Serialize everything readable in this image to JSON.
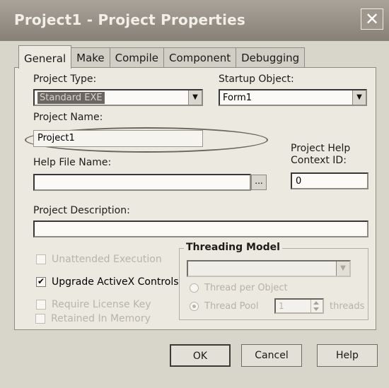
{
  "window": {
    "title": "Project1 - Project Properties",
    "close_glyph": "✕"
  },
  "tabs": [
    {
      "label": "General"
    },
    {
      "label": "Make"
    },
    {
      "label": "Compile"
    },
    {
      "label": "Component"
    },
    {
      "label": "Debugging"
    }
  ],
  "general": {
    "project_type_label": "Project Type:",
    "project_type_value": "Standard EXE",
    "startup_object_label": "Startup Object:",
    "startup_object_value": "Form1",
    "project_name_label": "Project Name:",
    "project_name_value": "Project1",
    "help_file_label": "Help File Name:",
    "help_file_value": "",
    "help_browse_label": "...",
    "help_context_label_1": "Project Help",
    "help_context_label_2": "Context ID:",
    "help_context_value": "0",
    "description_label": "Project Description:",
    "description_value": "",
    "unattended_label": "Unattended Execution",
    "upgrade_activex_label": "Upgrade ActiveX Controls",
    "upgrade_activex_checked": true,
    "require_license_label": "Require License Key",
    "retained_label": "Retained In Memory",
    "threading": {
      "title": "Threading Model",
      "combo_value": "",
      "thread_per_object_label": "Thread per Object",
      "thread_pool_label": "Thread Pool",
      "pool_value": "1",
      "threads_label": "threads"
    }
  },
  "buttons": {
    "ok": "OK",
    "cancel": "Cancel",
    "help": "Help"
  }
}
